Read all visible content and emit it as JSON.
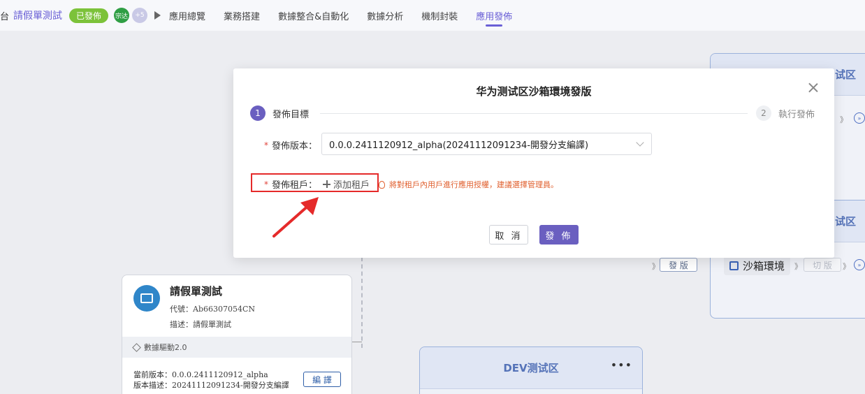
{
  "topbar": {
    "crumb_fragment": "台",
    "app_name": "請假單測試",
    "status_badge": "已發佈",
    "avatar_label": "宗达",
    "avatar_more": "+5",
    "tabs": [
      {
        "label": "應用總覽"
      },
      {
        "label": "業務搭建"
      },
      {
        "label": "數據整合&自動化"
      },
      {
        "label": "數據分析"
      },
      {
        "label": "機制封裝"
      },
      {
        "label": "應用發佈",
        "active": true
      }
    ]
  },
  "background": {
    "app_card": {
      "title": "請假單測試",
      "code": "代號：Ab66307054CN",
      "desc": "描述：請假單測試",
      "engine": "數據驅動2.0",
      "current_version": "當前版本：0.0.0.2411120912_alpha",
      "version_desc": "版本描述：20241112091234-開發分支編譯",
      "edit_label": "編 譯"
    },
    "dev_zone": {
      "title": "DEV测试区",
      "more": "•••"
    },
    "right_zone_1": {
      "title_fragment": "试区"
    },
    "right_zone_2": {
      "title_fragment": "试区"
    },
    "sandbox_label": "沙箱環境",
    "release_label": "發 版",
    "switch_label": "切 版",
    "chev": "》"
  },
  "modal": {
    "title": "华为测试区沙箱環境發版",
    "steps": [
      {
        "num": "1",
        "label": "發佈目標"
      },
      {
        "num": "2",
        "label": "執行發佈"
      }
    ],
    "version_field": {
      "required_mark": "*",
      "label": "發佈版本：",
      "value": "0.0.0.2411120912_alpha(20241112091234-開發分支編譯)"
    },
    "tenant_field": {
      "required_mark": "*",
      "label": "發佈租戶：",
      "add_label": "添加租戶"
    },
    "tip": "將對租戶內用戶進行應用授權，建議選擇管理員。",
    "cancel_label": "取 消",
    "publish_label": "發 佈"
  },
  "colors": {
    "accent": "#6a5fc0",
    "highlight": "#e52a2a",
    "tip": "#e0602f",
    "badge": "#7cc23a"
  }
}
